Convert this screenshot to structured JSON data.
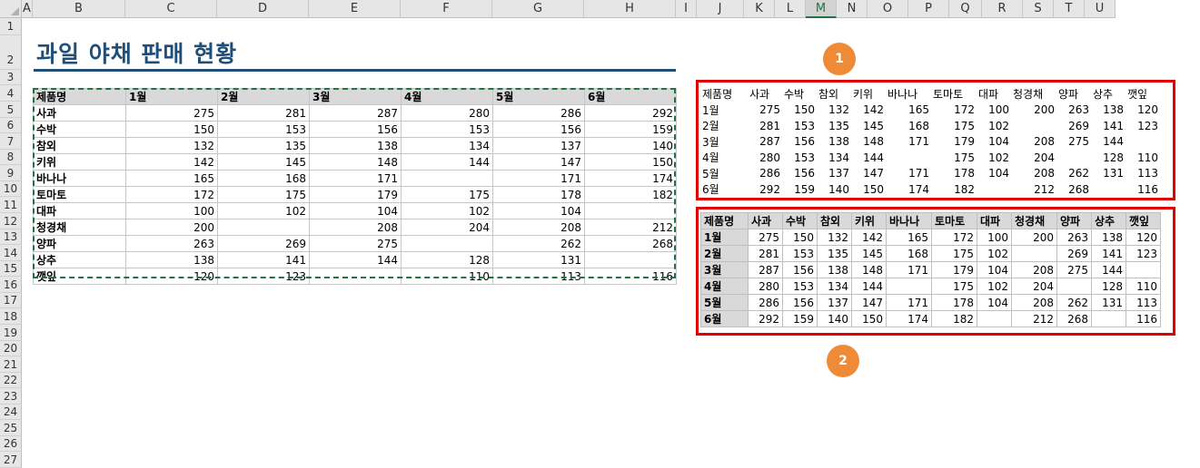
{
  "sheet": {
    "columns": [
      "A",
      "B",
      "C",
      "D",
      "E",
      "F",
      "G",
      "H",
      "I",
      "J",
      "K",
      "L",
      "M",
      "N",
      "O",
      "P",
      "Q",
      "R",
      "S",
      "T",
      "U"
    ],
    "selected_column": "M",
    "rows": [
      "1",
      "2",
      "3",
      "4",
      "5",
      "6",
      "7",
      "8",
      "9",
      "10",
      "11",
      "12",
      "13",
      "14",
      "15",
      "16",
      "17",
      "18",
      "19",
      "20",
      "21",
      "22",
      "23",
      "24",
      "25",
      "26",
      "27"
    ]
  },
  "title": "과일 야채 판매 현황",
  "main_table": {
    "header": [
      "제품명",
      "1월",
      "2월",
      "3월",
      "4월",
      "5월",
      "6월"
    ],
    "rows": [
      [
        "사과",
        "275",
        "281",
        "287",
        "280",
        "286",
        "292"
      ],
      [
        "수박",
        "150",
        "153",
        "156",
        "153",
        "156",
        "159"
      ],
      [
        "참외",
        "132",
        "135",
        "138",
        "134",
        "137",
        "140"
      ],
      [
        "키위",
        "142",
        "145",
        "148",
        "144",
        "147",
        "150"
      ],
      [
        "바나나",
        "165",
        "168",
        "171",
        "",
        "171",
        "174"
      ],
      [
        "토마토",
        "172",
        "175",
        "179",
        "175",
        "178",
        "182"
      ],
      [
        "대파",
        "100",
        "102",
        "104",
        "102",
        "104",
        ""
      ],
      [
        "청경채",
        "200",
        "",
        "208",
        "204",
        "208",
        "212"
      ],
      [
        "양파",
        "263",
        "269",
        "275",
        "",
        "262",
        "268"
      ],
      [
        "상추",
        "138",
        "141",
        "144",
        "128",
        "131",
        ""
      ],
      [
        "깻잎",
        "120",
        "123",
        "",
        "110",
        "113",
        "116"
      ]
    ]
  },
  "transposed_table": {
    "header": [
      "제품명",
      "사과",
      "수박",
      "참외",
      "키위",
      "바나나",
      "토마토",
      "대파",
      "청경채",
      "양파",
      "상추",
      "깻잎"
    ],
    "rows": [
      [
        "1월",
        "275",
        "150",
        "132",
        "142",
        "165",
        "172",
        "100",
        "200",
        "263",
        "138",
        "120"
      ],
      [
        "2월",
        "281",
        "153",
        "135",
        "145",
        "168",
        "175",
        "102",
        "",
        "269",
        "141",
        "123"
      ],
      [
        "3월",
        "287",
        "156",
        "138",
        "148",
        "171",
        "179",
        "104",
        "208",
        "275",
        "144",
        ""
      ],
      [
        "4월",
        "280",
        "153",
        "134",
        "144",
        "",
        "175",
        "102",
        "204",
        "",
        "128",
        "110"
      ],
      [
        "5월",
        "286",
        "156",
        "137",
        "147",
        "171",
        "178",
        "104",
        "208",
        "262",
        "131",
        "113"
      ],
      [
        "6월",
        "292",
        "159",
        "140",
        "150",
        "174",
        "182",
        "",
        "212",
        "268",
        "",
        "116"
      ]
    ]
  },
  "badges": {
    "one": "1",
    "two": "2"
  },
  "colors": {
    "accent": "#1f4e79",
    "highlight": "#e00000",
    "badge": "#ef8b37",
    "copy_marquee": "#217346"
  }
}
